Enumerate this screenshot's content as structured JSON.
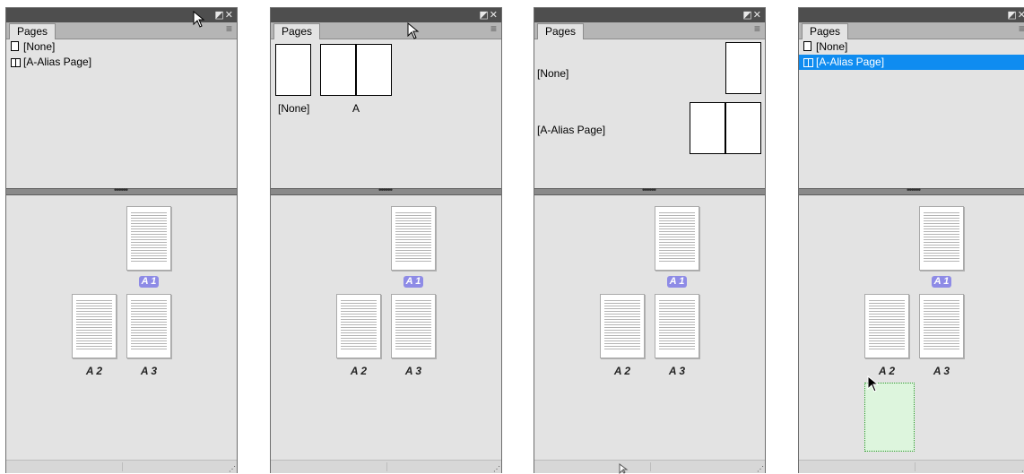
{
  "panel_title": "Pages",
  "titlebar_icons": "◩✕",
  "menu_icon": "≡",
  "grip": "••••••",
  "panel_a": {
    "masters": [
      {
        "icon": "single-page-icon",
        "label": "[None]"
      },
      {
        "icon": "spread-page-icon",
        "label": "[A-Alias Page]"
      }
    ]
  },
  "panel_b": {
    "masters": [
      {
        "label": "[None]"
      },
      {
        "label": "A"
      }
    ]
  },
  "panel_c": {
    "masters": [
      {
        "label": "[None]"
      },
      {
        "label": "[A-Alias Page]"
      }
    ]
  },
  "panel_d": {
    "masters": [
      {
        "icon": "single-page-icon",
        "label": "[None]"
      },
      {
        "icon": "spread-page-icon",
        "label": "[A-Alias Page]",
        "selected": true
      }
    ]
  },
  "document_pages": [
    {
      "page": "1",
      "master_prefix": "A",
      "badge": "A 1"
    },
    {
      "page": "2",
      "master_prefix": "A",
      "badge": "A 2"
    },
    {
      "page": "3",
      "master_prefix": "A",
      "badge": "A 3"
    }
  ],
  "colors": {
    "selection": "#0f8cf0",
    "page_badge": "#8e8be6",
    "drop_target": "#ddf5dd"
  }
}
